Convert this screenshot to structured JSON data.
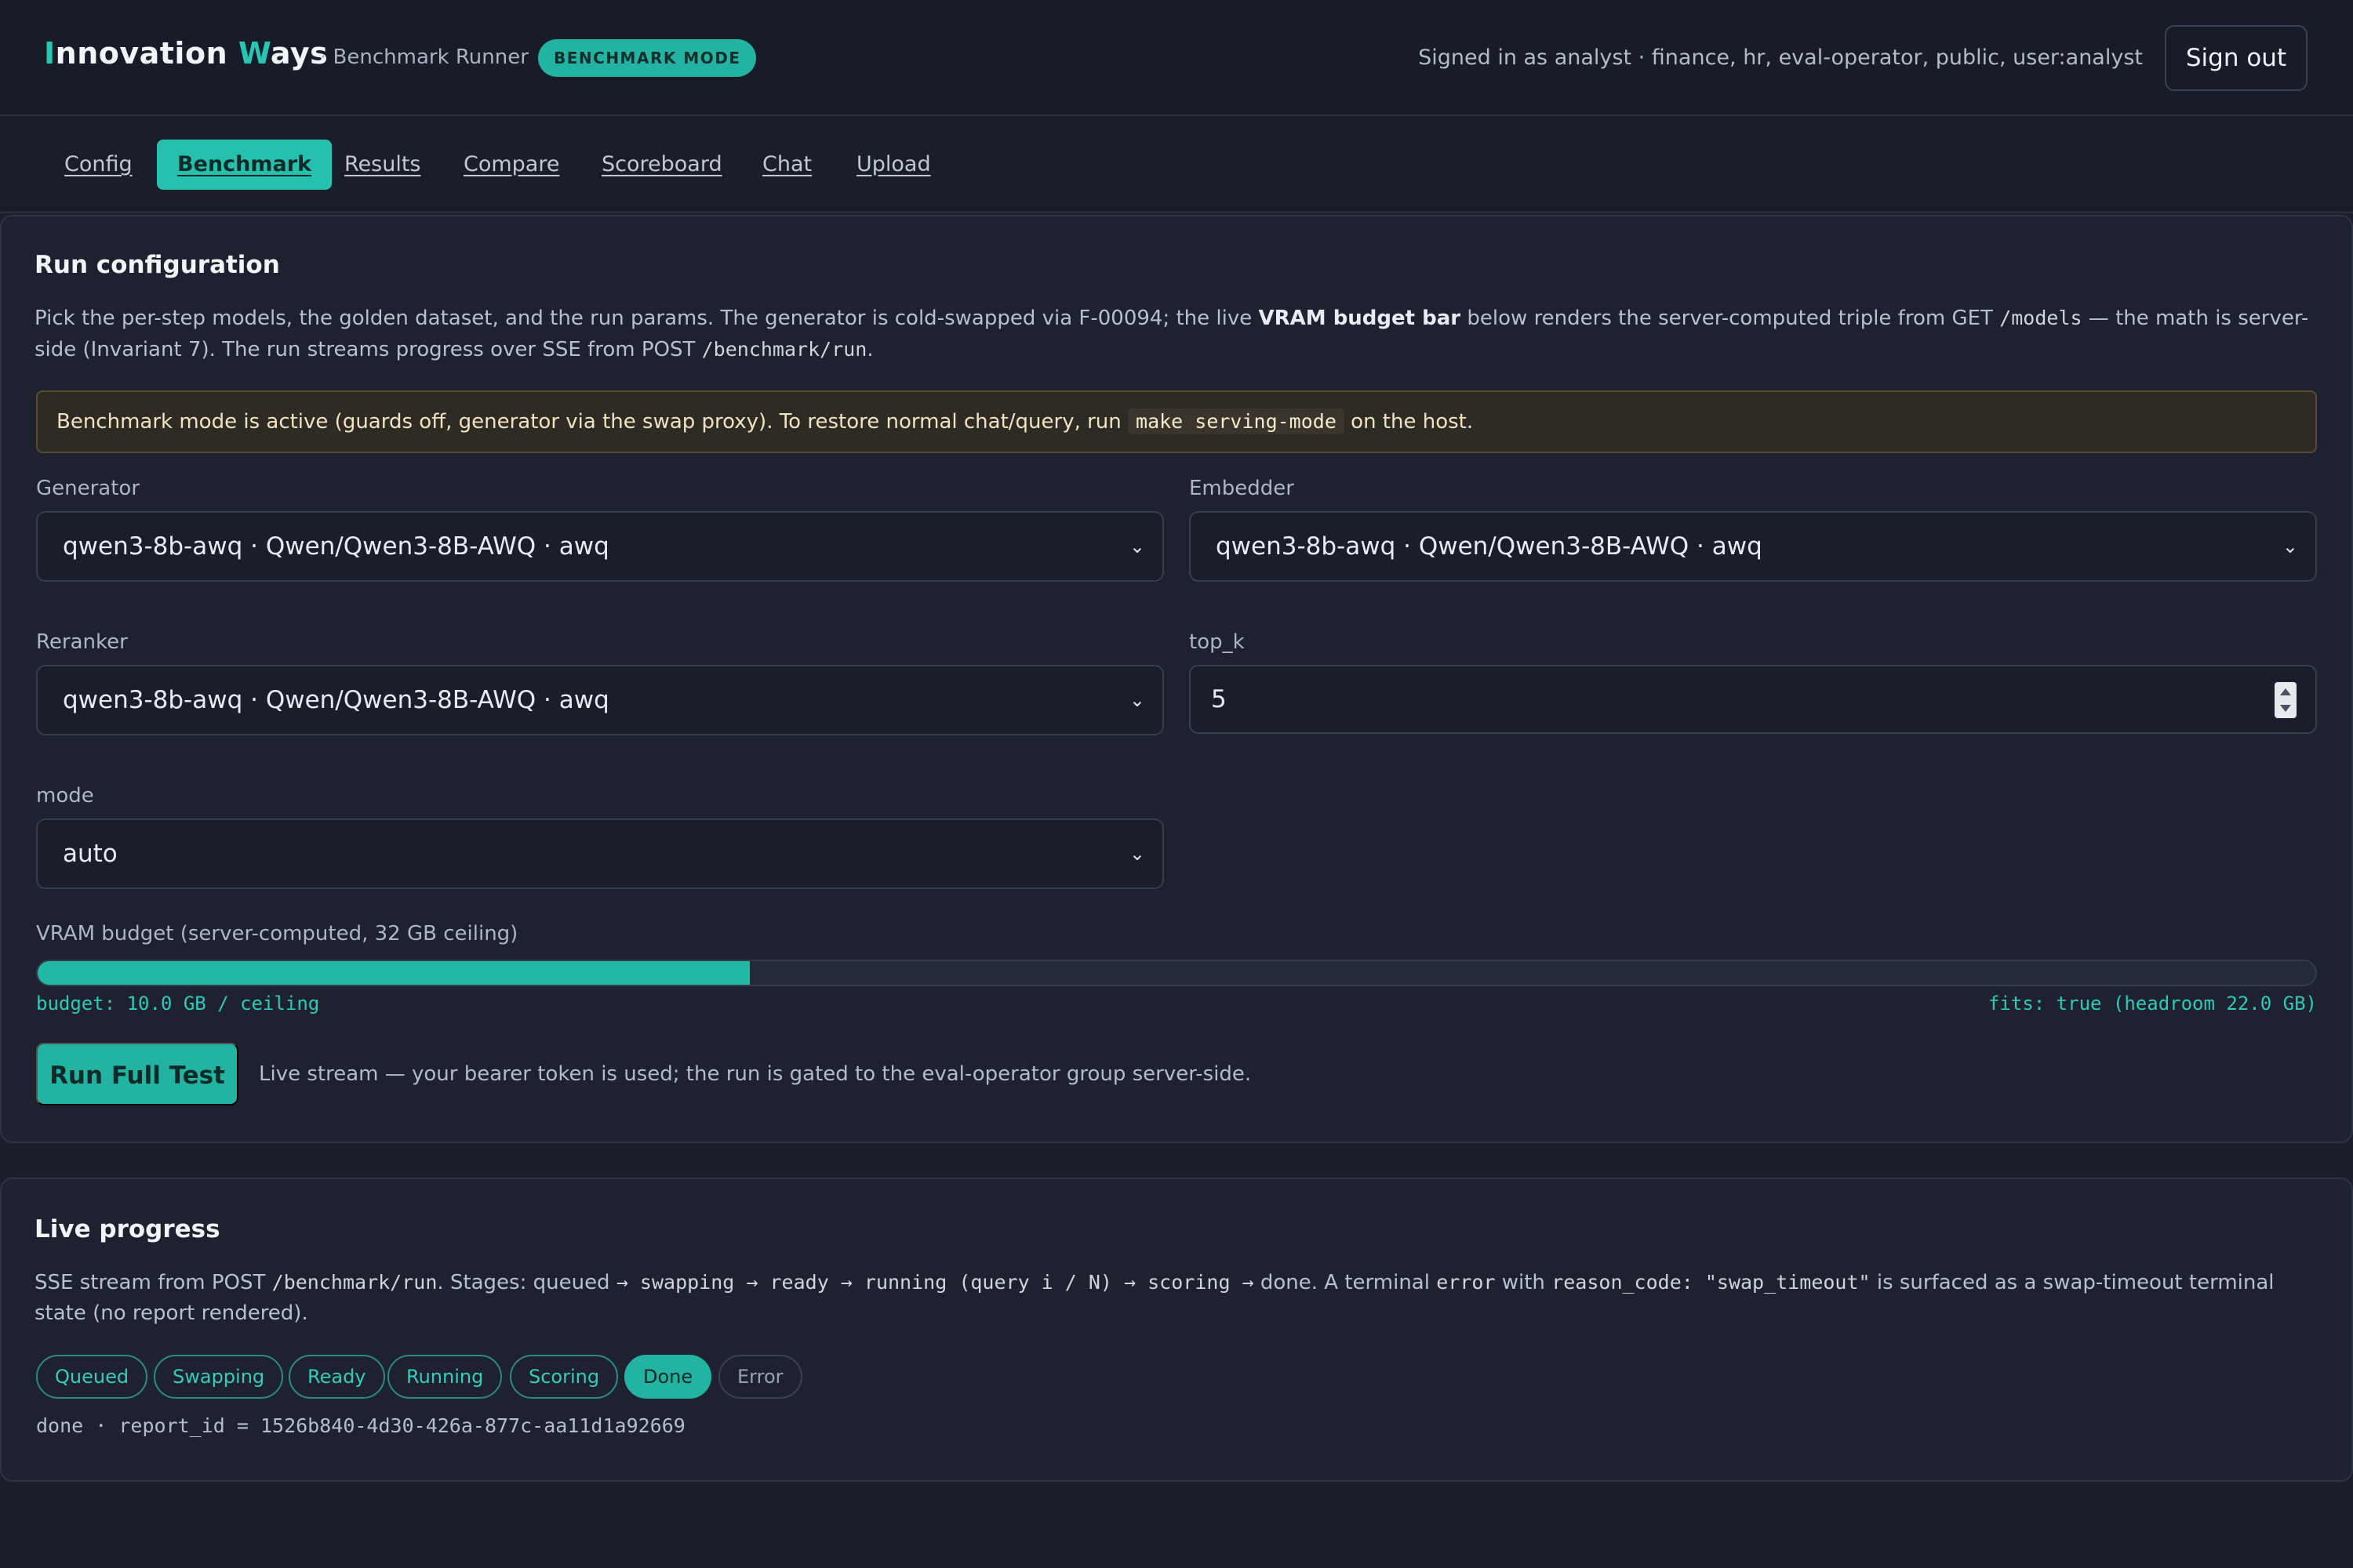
{
  "header": {
    "brand_first_initial": "I",
    "brand_first_rest": "nnovation ",
    "brand_second_initial": "W",
    "brand_second_rest": "ays",
    "subtitle": "· Benchmark Runner",
    "mode_badge": "BENCHMARK MODE",
    "signed_in": "Signed in as analyst · finance, hr, eval-operator, public, user:analyst",
    "sign_out": "Sign out"
  },
  "nav": {
    "tabs": [
      {
        "label": "Config",
        "active": false
      },
      {
        "label": "Benchmark",
        "active": true
      },
      {
        "label": "Results",
        "active": false
      },
      {
        "label": "Compare",
        "active": false
      },
      {
        "label": "Scoreboard",
        "active": false
      },
      {
        "label": "Chat",
        "active": false
      },
      {
        "label": "Upload",
        "active": false
      }
    ]
  },
  "run_config": {
    "title": "Run configuration",
    "desc_part1": "Pick the per-step models, the golden dataset, and the run params. The generator is cold-swapped via F-00094; the live ",
    "desc_bold": "VRAM budget bar",
    "desc_part2": " below renders the server-computed triple from GET ",
    "desc_code1": "/models",
    "desc_part3": " — the math is server-side (Invariant 7). The run streams progress over SSE from POST ",
    "desc_code2": "/benchmark/run",
    "desc_part4": ".",
    "notice_part1": "Benchmark mode is active (guards off, generator via the swap proxy). To restore normal chat/query, run ",
    "notice_code": "make serving-mode",
    "notice_part2": " on the host.",
    "generator": {
      "label": "Generator",
      "value": "qwen3-8b-awq · Qwen/Qwen3-8B-AWQ · awq"
    },
    "embedder": {
      "label": "Embedder",
      "value": "qwen3-8b-awq · Qwen/Qwen3-8B-AWQ · awq"
    },
    "reranker": {
      "label": "Reranker",
      "value": "qwen3-8b-awq · Qwen/Qwen3-8B-AWQ · awq"
    },
    "top_k": {
      "label": "top_k",
      "value": "5"
    },
    "mode": {
      "label": "mode",
      "value": "auto"
    },
    "vram": {
      "label": "VRAM budget (server-computed, 32 GB ceiling)",
      "fill_fraction": 0.3125,
      "left_text": "budget: 10.0 GB / ceiling",
      "right_text": "fits: true (headroom 22.0 GB)"
    },
    "run_button": "Run Full Test",
    "run_note": "Live stream — your bearer token is used; the run is gated to the eval-operator group server-side."
  },
  "live_progress": {
    "title": "Live progress",
    "desc_part1": "SSE stream from POST ",
    "desc_code1": "/benchmark/run",
    "desc_part2": ". Stages: queued ",
    "desc_code2": "→ swapping → ready → running (query i / N) → scoring →",
    "desc_part3": " done. A terminal ",
    "desc_code3": "error",
    "desc_part4": " with ",
    "desc_code4": "reason_code: \"swap_timeout\"",
    "desc_part5": " is surfaced as a swap-timeout terminal state (no report rendered).",
    "stages": [
      "Queued",
      "Swapping",
      "Ready",
      "Running",
      "Scoring",
      "Done",
      "Error"
    ],
    "result": "done · report_id = 1526b840-4d30-426a-877c-aa11d1a92669"
  },
  "colors": {
    "accent": "#22b3a2",
    "background": "#1b1f2c",
    "panel": "#1e2230",
    "notice_bg": "#2e2a24"
  }
}
